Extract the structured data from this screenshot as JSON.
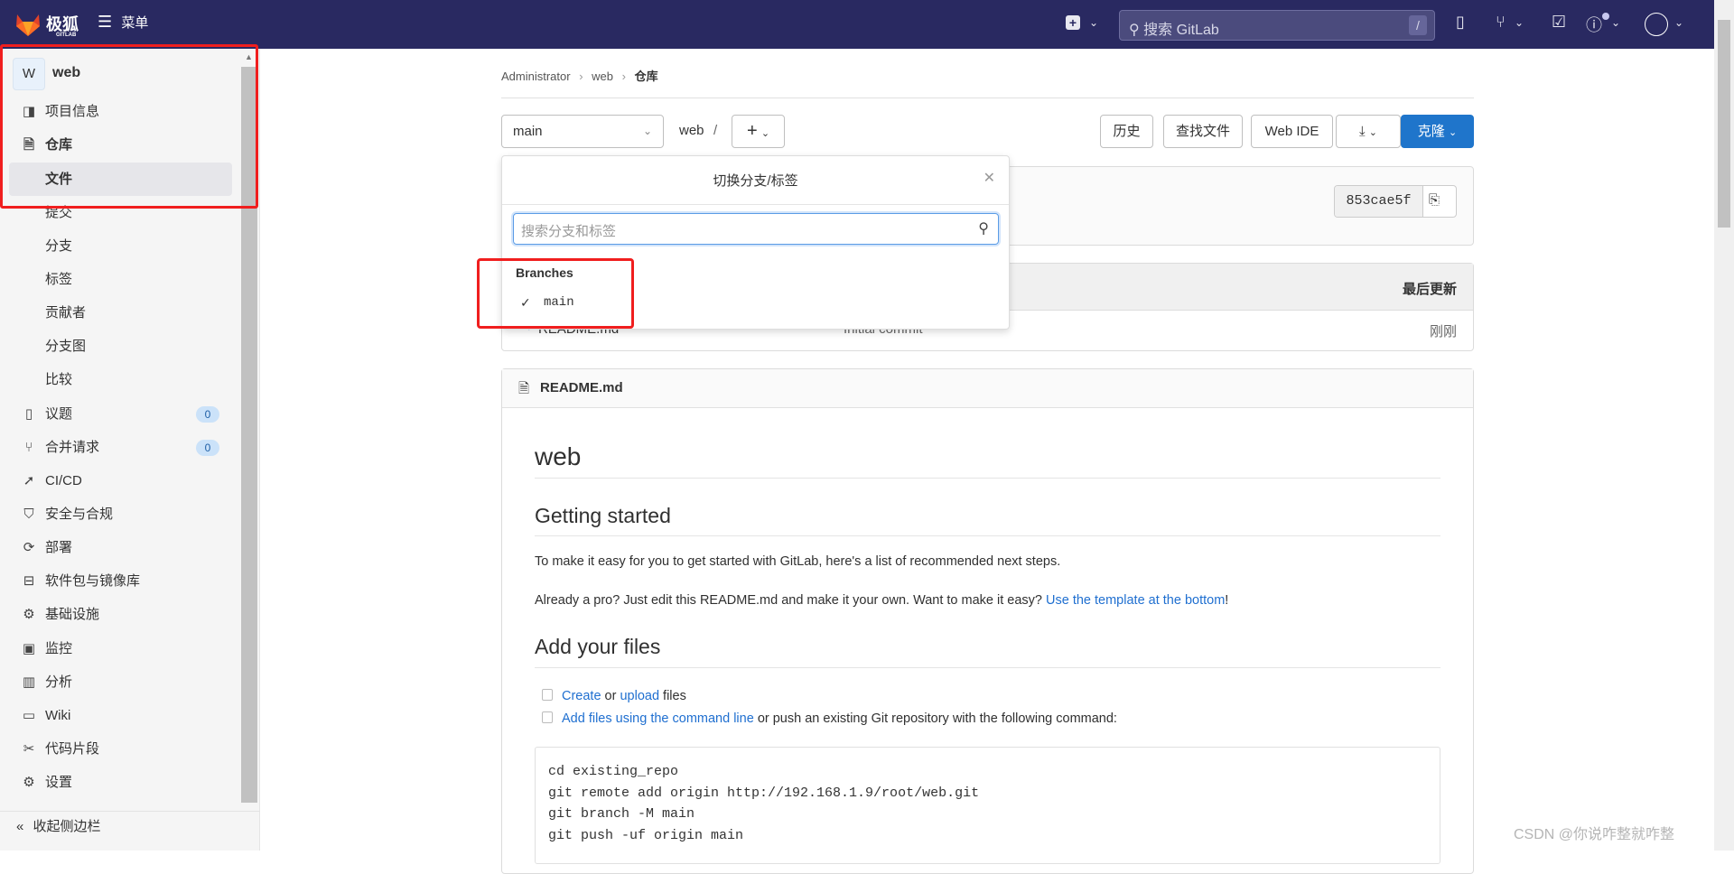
{
  "header": {
    "logo_text": "极狐",
    "logo_sub": "GITLAB",
    "menu_label": "菜单",
    "search_placeholder": "搜索 GitLab",
    "search_shortcut": "/",
    "brand_color": "#292961"
  },
  "sidebar": {
    "project_initial": "W",
    "project_name": "web",
    "items": [
      {
        "label": "项目信息",
        "icon": "project-icon"
      },
      {
        "label": "仓库",
        "icon": "document-icon"
      },
      {
        "label": "文件"
      },
      {
        "label": "提交"
      },
      {
        "label": "分支"
      },
      {
        "label": "标签"
      },
      {
        "label": "贡献者"
      },
      {
        "label": "分支图"
      },
      {
        "label": "比较"
      },
      {
        "label": "议题",
        "icon": "issues-icon",
        "badge": "0"
      },
      {
        "label": "合并请求",
        "icon": "merge-request-icon",
        "badge": "0"
      },
      {
        "label": "CI/CD",
        "icon": "rocket-icon"
      },
      {
        "label": "安全与合规",
        "icon": "shield-icon"
      },
      {
        "label": "部署",
        "icon": "deploy-icon"
      },
      {
        "label": "软件包与镜像库",
        "icon": "package-icon"
      },
      {
        "label": "基础设施",
        "icon": "cloud-gear-icon"
      },
      {
        "label": "监控",
        "icon": "monitor-icon"
      },
      {
        "label": "分析",
        "icon": "chart-icon"
      },
      {
        "label": "Wiki",
        "icon": "book-icon"
      },
      {
        "label": "代码片段",
        "icon": "snippet-icon"
      },
      {
        "label": "设置",
        "icon": "gear-icon"
      }
    ],
    "collapse_label": "收起侧边栏"
  },
  "breadcrumb": [
    "Administrator",
    "web",
    "仓库"
  ],
  "toolbar": {
    "branch": "main",
    "path": "web",
    "path_sep": "/",
    "history": "历史",
    "find_file": "查找文件",
    "web_ide": "Web IDE",
    "clone": "克隆",
    "accent": "#1f75cb"
  },
  "commit": {
    "sha": "853cae5f"
  },
  "dropdown": {
    "title": "切换分支/标签",
    "search_placeholder": "搜索分支和标签",
    "section": "Branches",
    "branches": [
      {
        "name": "main",
        "selected": true
      }
    ]
  },
  "files": {
    "last_update_header": "最后更新",
    "rows": [
      {
        "name": "README.md",
        "commit": "Initial commit",
        "updated": "刚刚"
      }
    ]
  },
  "readme": {
    "filename": "README.md",
    "h1": "web",
    "h2_getting": "Getting started",
    "p1": "To make it easy for you to get started with GitLab, here's a list of recommended next steps.",
    "p2_text": "Already a pro? Just edit this README.md and make it your own. Want to make it easy? ",
    "p2_link": "Use the template at the bottom",
    "p2_end": "!",
    "h2_add": "Add your files",
    "task1_link1": "Create",
    "task1_or": " or ",
    "task1_link2": "upload",
    "task1_end": " files",
    "task2_link": "Add files using the command line",
    "task2_text": " or push an existing Git repository with the following command:",
    "code": [
      "cd existing_repo",
      "git remote add origin http://192.168.1.9/root/web.git",
      "git branch -M main",
      "git push -uf origin main"
    ]
  },
  "watermark": "CSDN @你说咋整就咋整"
}
